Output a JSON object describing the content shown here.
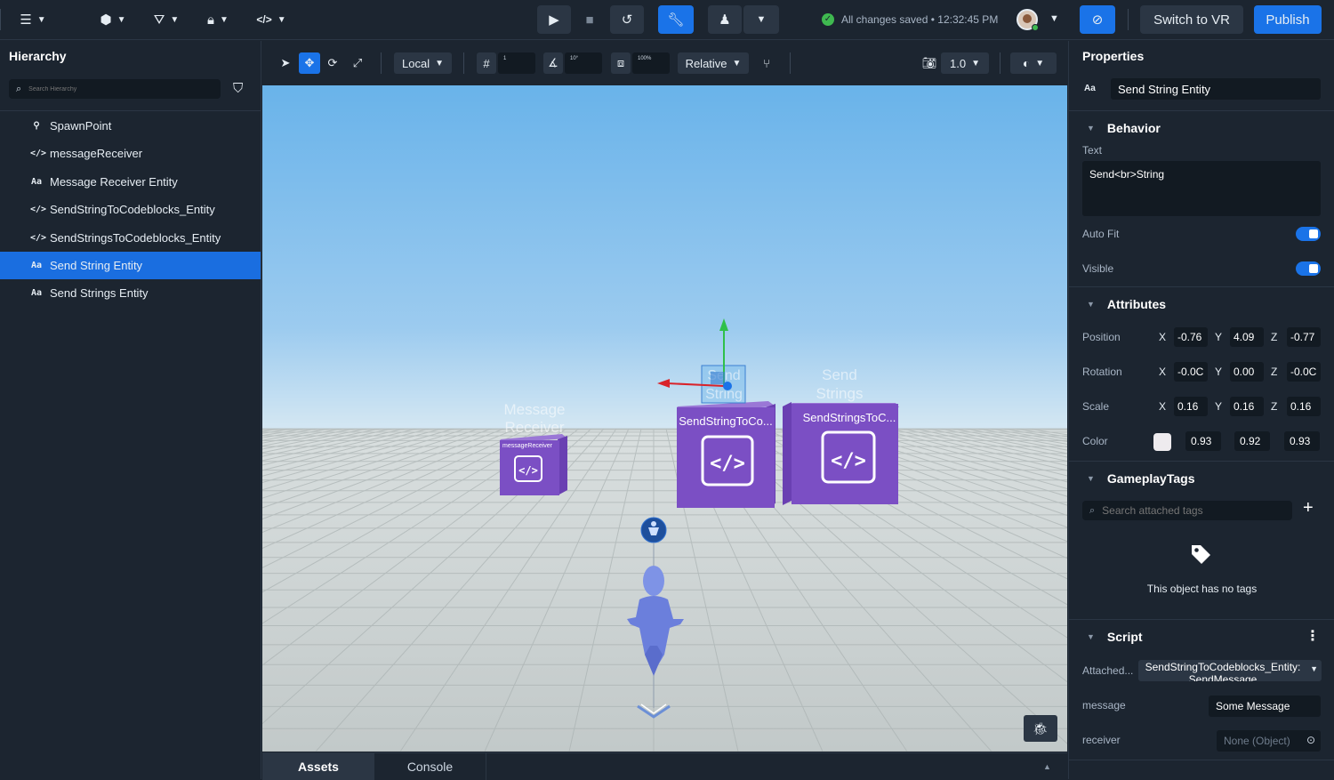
{
  "topbar": {
    "status_text": "All changes saved • 12:32:45 PM",
    "switch_vr_label": "Switch to VR",
    "publish_label": "Publish"
  },
  "hierarchy": {
    "title": "Hierarchy",
    "search_placeholder": "Search Hierarchy",
    "items": [
      {
        "label": "SpawnPoint",
        "icon": "spawn-icon",
        "glyph": "⚲",
        "selected": false
      },
      {
        "label": "messageReceiver",
        "icon": "code-icon",
        "glyph": "</>",
        "selected": false
      },
      {
        "label": "Message Receiver Entity",
        "icon": "text-icon",
        "glyph": "Aa",
        "selected": false
      },
      {
        "label": "SendStringToCodeblocks_Entity",
        "icon": "code-icon",
        "glyph": "</>",
        "selected": false
      },
      {
        "label": "SendStringsToCodeblocks_Entity",
        "icon": "code-icon",
        "glyph": "</>",
        "selected": false
      },
      {
        "label": "Send String Entity",
        "icon": "text-icon",
        "glyph": "Aa",
        "selected": true
      },
      {
        "label": "Send Strings Entity",
        "icon": "text-icon",
        "glyph": "Aa",
        "selected": false
      }
    ]
  },
  "viewport_toolbar": {
    "space_label": "Local",
    "grid_value": "1",
    "angle_value": "10°",
    "scale_value": "100%",
    "mode_label": "Relative",
    "camera_speed": "1.0"
  },
  "scene": {
    "message_receiver_label": "Message\nReceiver",
    "message_receiver_box_label": "messageReceiver",
    "send_string_label": "Send\nString",
    "send_string_box_label": "SendStringToCo...",
    "send_strings_label": "Send\nStrings",
    "send_strings_box_label": "SendStringsToC...",
    "code_glyph": "</>",
    "sky_color": "#69b3ea",
    "floor_color": "#c9d0d0",
    "box_color": "#7b4fc4"
  },
  "bottom_tabs": {
    "assets": "Assets",
    "console": "Console"
  },
  "properties": {
    "title": "Properties",
    "entity_name": "Send String Entity",
    "behavior": {
      "title": "Behavior",
      "text_label": "Text",
      "text_value": "Send<br>String",
      "auto_fit_label": "Auto Fit",
      "auto_fit": true,
      "visible_label": "Visible",
      "visible": true
    },
    "attributes": {
      "title": "Attributes",
      "position_label": "Position",
      "position": {
        "x": "-0.76",
        "y": "4.09",
        "z": "-0.77"
      },
      "rotation_label": "Rotation",
      "rotation": {
        "x": "-0.0C",
        "y": "0.00",
        "z": "-0.0C"
      },
      "scale_label": "Scale",
      "scale": {
        "x": "0.16",
        "y": "0.16",
        "z": "0.16"
      },
      "color_label": "Color",
      "color": {
        "r": "0.93",
        "g": "0.92",
        "b": "0.93"
      },
      "axis_x": "X",
      "axis_y": "Y",
      "axis_z": "Z"
    },
    "gameplay_tags": {
      "title": "GameplayTags",
      "search_placeholder": "Search attached tags",
      "empty_text": "This object has no tags"
    },
    "script": {
      "title": "Script",
      "attached_label": "Attached...",
      "attached_value": "SendStringToCodeblocks_Entity: SendMessage",
      "message_label": "message",
      "message_value": "Some Message",
      "receiver_label": "receiver",
      "receiver_value": "None (Object)"
    }
  }
}
